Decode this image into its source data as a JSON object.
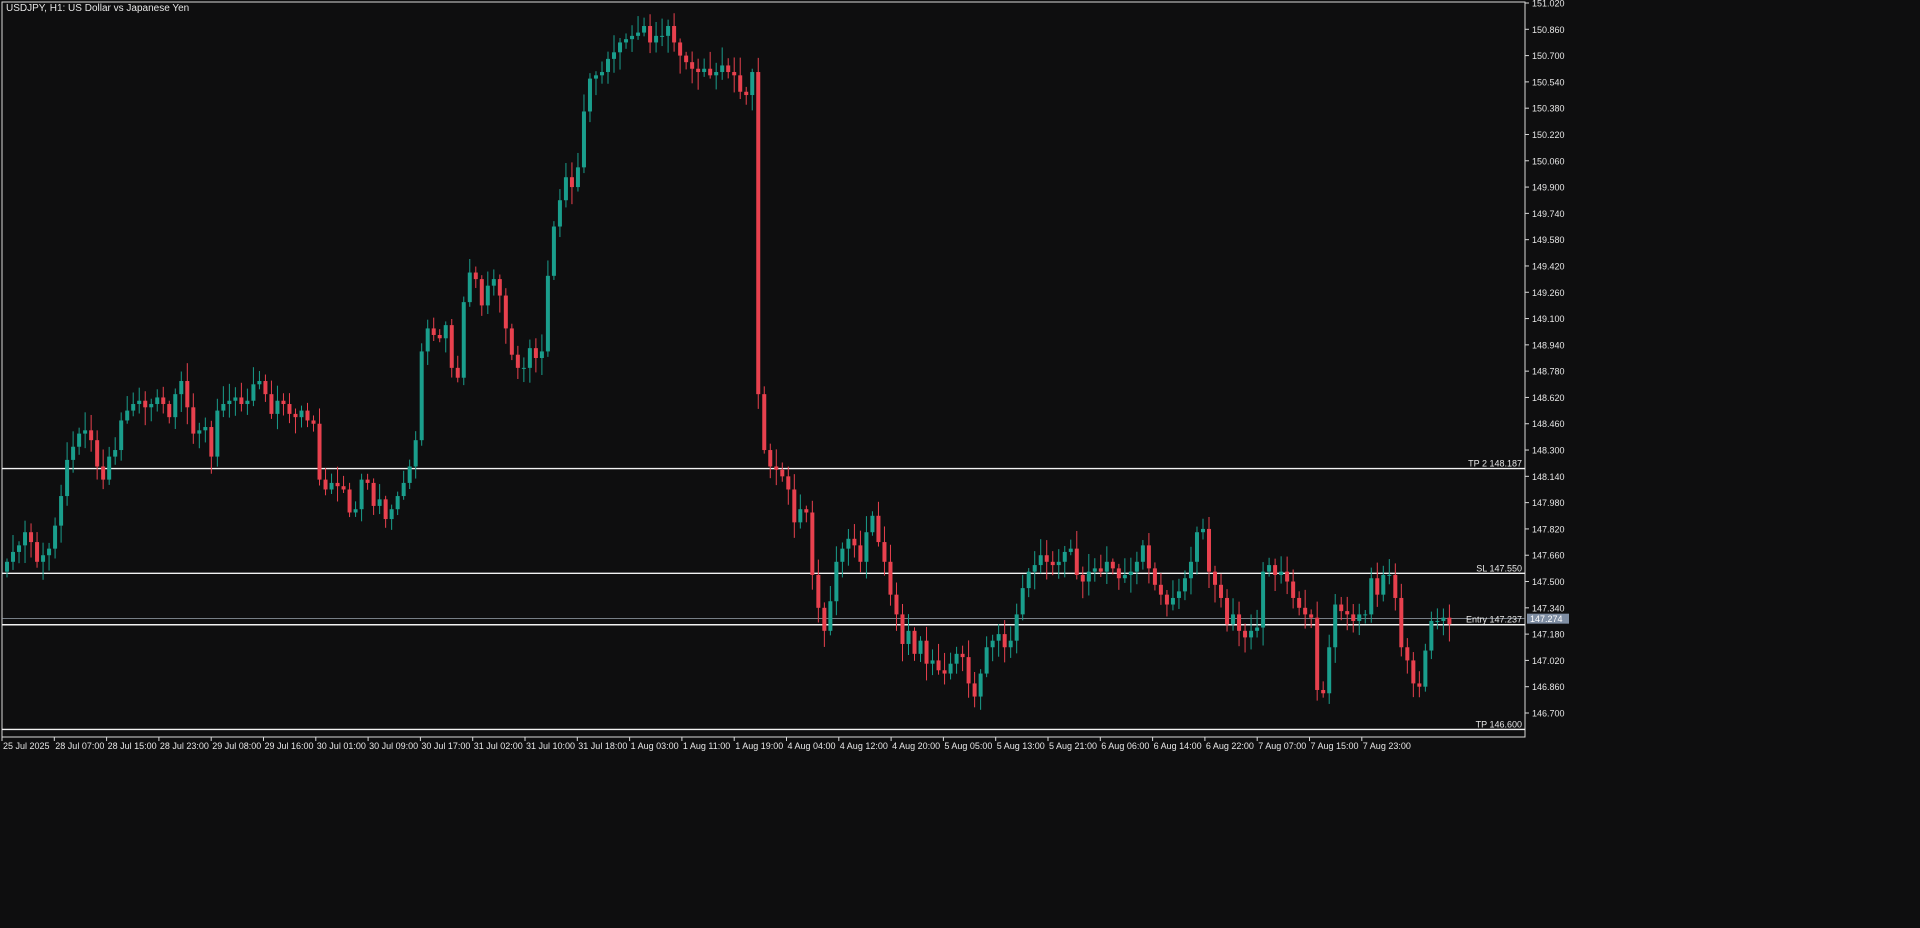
{
  "title": "USDJPY, H1:  US Dollar vs Japanese Yen",
  "colors": {
    "background": "#0e0e0f",
    "axis": "#d9d9d9",
    "text": "#e6e6e6",
    "bull": "#1a9e8c",
    "bear": "#e8414e",
    "level_line": "#f2f2f2",
    "current_price_box": "#7f8ea3"
  },
  "price_axis": {
    "min": 146.46,
    "max": 151.02,
    "ticks": [
      "151.020",
      "150.860",
      "150.700",
      "150.540",
      "150.380",
      "150.220",
      "150.060",
      "149.900",
      "149.740",
      "149.580",
      "149.420",
      "149.260",
      "149.100",
      "148.940",
      "148.780",
      "148.620",
      "148.460",
      "148.300",
      "148.140",
      "147.980",
      "147.820",
      "147.660",
      "147.500",
      "147.340",
      "147.180",
      "147.020",
      "146.860",
      "146.700"
    ]
  },
  "time_axis": {
    "labels": [
      "25 Jul 2025",
      "28 Jul 07:00",
      "28 Jul 15:00",
      "28 Jul 23:00",
      "29 Jul 08:00",
      "29 Jul 16:00",
      "30 Jul 01:00",
      "30 Jul 09:00",
      "30 Jul 17:00",
      "31 Jul 02:00",
      "31 Jul 10:00",
      "31 Jul 18:00",
      "1 Aug 03:00",
      "1 Aug 11:00",
      "1 Aug 19:00",
      "4 Aug 04:00",
      "4 Aug 12:00",
      "4 Aug 20:00",
      "5 Aug 05:00",
      "5 Aug 13:00",
      "5 Aug 21:00",
      "6 Aug 06:00",
      "6 Aug 14:00",
      "6 Aug 22:00",
      "7 Aug 07:00",
      "7 Aug 15:00",
      "7 Aug 23:00"
    ]
  },
  "levels": [
    {
      "label": "TP 2 148.187",
      "price": 148.187
    },
    {
      "label": "SL 147.550",
      "price": 147.55
    },
    {
      "label": "Entry 147.237",
      "price": 147.237
    },
    {
      "label": "TP 146.600",
      "price": 146.6
    }
  ],
  "current_price": {
    "label": "147.274",
    "price": 147.274,
    "line_price": 147.274
  },
  "chart_data": {
    "type": "candlestick",
    "series_closes": [
      147.62,
      147.68,
      147.72,
      147.8,
      147.74,
      147.62,
      147.66,
      147.7,
      147.84,
      148.02,
      148.24,
      148.32,
      148.4,
      148.42,
      148.36,
      148.2,
      148.12,
      148.26,
      148.3,
      148.48,
      148.54,
      148.58,
      148.6,
      148.56,
      148.58,
      148.62,
      148.58,
      148.5,
      148.64,
      148.72,
      148.56,
      148.4,
      148.42,
      148.44,
      148.26,
      148.54,
      148.58,
      148.6,
      148.62,
      148.58,
      148.6,
      148.7,
      148.72,
      148.64,
      148.52,
      148.6,
      148.58,
      148.52,
      148.5,
      148.54,
      148.48,
      148.46,
      148.12,
      148.06,
      148.1,
      148.08,
      148.06,
      147.92,
      147.94,
      148.12,
      148.1,
      147.96,
      148.0,
      147.88,
      147.94,
      148.02,
      148.1,
      148.2,
      148.36,
      148.9,
      149.04,
      149.0,
      148.98,
      149.06,
      148.8,
      148.74,
      149.2,
      149.38,
      149.34,
      149.18,
      149.3,
      149.34,
      149.24,
      149.04,
      148.88,
      148.8,
      148.8,
      148.92,
      148.86,
      148.9,
      149.36,
      149.66,
      149.82,
      149.96,
      149.9,
      150.02,
      150.36,
      150.56,
      150.58,
      150.6,
      150.68,
      150.72,
      150.78,
      150.8,
      150.82,
      150.84,
      150.88,
      150.78,
      150.82,
      150.82,
      150.88,
      150.78,
      150.7,
      150.66,
      150.62,
      150.6,
      150.62,
      150.58,
      150.6,
      150.64,
      150.6,
      150.58,
      150.48,
      150.46,
      150.6,
      148.64,
      148.3,
      148.2,
      148.18,
      148.14,
      148.06,
      147.86,
      147.94,
      147.92,
      147.54,
      147.34,
      147.2,
      147.38,
      147.62,
      147.7,
      147.76,
      147.72,
      147.62,
      147.8,
      147.9,
      147.74,
      147.62,
      147.42,
      147.3,
      147.12,
      147.2,
      147.06,
      147.14,
      147.0,
      147.02,
      146.96,
      146.94,
      147.0,
      147.06,
      147.04,
      146.88,
      146.8,
      146.94,
      147.1,
      147.14,
      147.18,
      147.1,
      147.14,
      147.3,
      147.46,
      147.56,
      147.6,
      147.66,
      147.62,
      147.6,
      147.62,
      147.68,
      147.7,
      147.54,
      147.5,
      147.56,
      147.58,
      147.56,
      147.62,
      147.58,
      147.52,
      147.54,
      147.56,
      147.62,
      147.72,
      147.58,
      147.48,
      147.42,
      147.36,
      147.4,
      147.44,
      147.52,
      147.62,
      147.8,
      147.82,
      147.56,
      147.48,
      147.4,
      147.24,
      147.3,
      147.2,
      147.16,
      147.2,
      147.22,
      147.56,
      147.6,
      147.54,
      147.56,
      147.5,
      147.4,
      147.34,
      147.3,
      147.28,
      146.84,
      146.82,
      147.1,
      147.36,
      147.32,
      147.3,
      147.26,
      147.3,
      147.3,
      147.52,
      147.42,
      147.54,
      147.54,
      147.4,
      147.1,
      147.02,
      146.88,
      146.86,
      147.08,
      147.26,
      147.26,
      147.28,
      147.24
    ]
  }
}
